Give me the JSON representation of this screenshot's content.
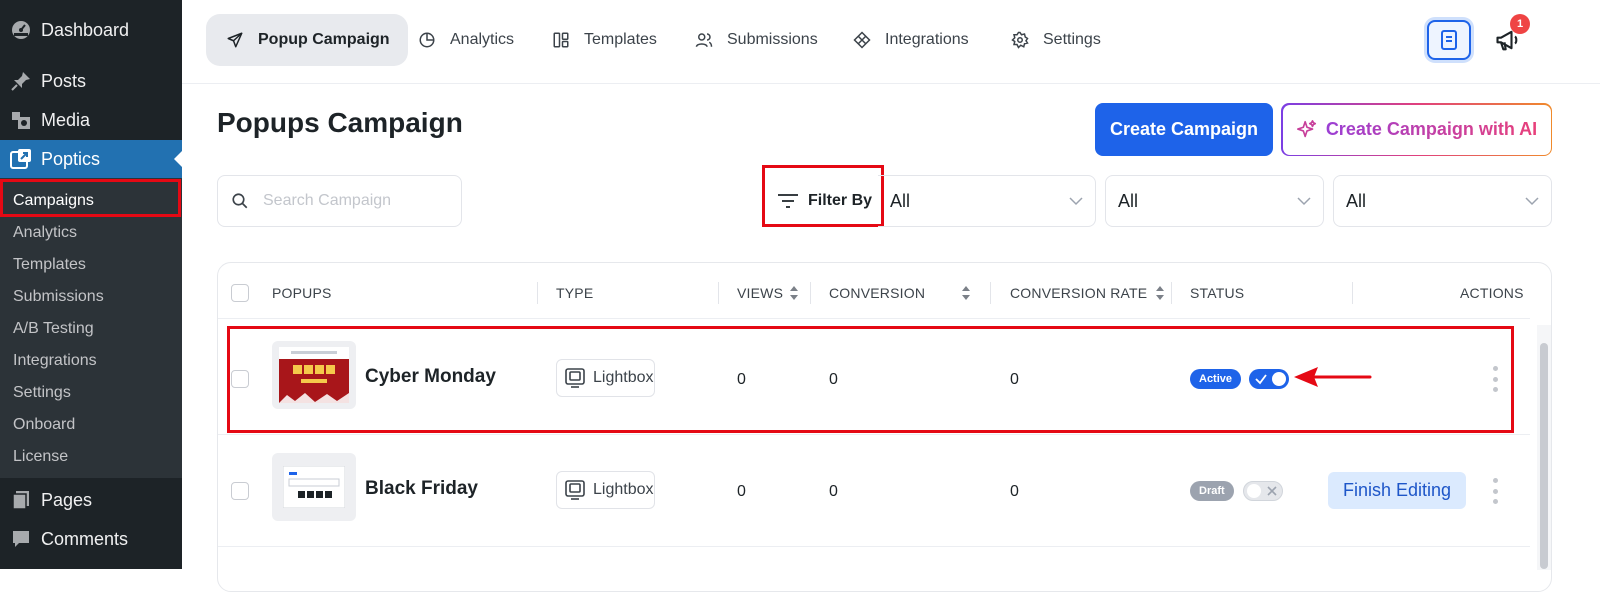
{
  "wp_menu": {
    "dashboard": "Dashboard",
    "posts": "Posts",
    "media": "Media",
    "poptics": "Poptics",
    "pages": "Pages",
    "comments": "Comments"
  },
  "submenu": [
    "Campaigns",
    "Analytics",
    "Templates",
    "Submissions",
    "A/B Testing",
    "Integrations",
    "Settings",
    "Onboard",
    "License"
  ],
  "top_tabs": {
    "popup_campaign": "Popup Campaign",
    "analytics": "Analytics",
    "templates": "Templates",
    "submissions": "Submissions",
    "integrations": "Integrations",
    "settings": "Settings"
  },
  "notification_count": "1",
  "header": {
    "title": "Popups Campaign",
    "create_label": "Create Campaign",
    "create_ai_label": "Create Campaign with AI"
  },
  "filters": {
    "search_placeholder": "Search Campaign",
    "filter_label": "Filter By",
    "select_1": "All",
    "select_2": "All",
    "select_3": "All"
  },
  "table": {
    "columns": {
      "popups": "POPUPS",
      "type": "TYPE",
      "views": "VIEWS",
      "conversion": "CONVERSION",
      "conversion_rate": "CONVERSION RATE",
      "status": "STATUS",
      "actions": "ACTIONS"
    },
    "rows": [
      {
        "name": "Cyber Monday",
        "type": "Lightbox",
        "views": "0",
        "conversion": "0",
        "conversion_rate": "0",
        "status": "Active",
        "enabled": true
      },
      {
        "name": "Black Friday",
        "type": "Lightbox",
        "views": "0",
        "conversion": "0",
        "conversion_rate": "0",
        "status": "Draft",
        "enabled": false,
        "action": "Finish Editing"
      }
    ]
  },
  "colors": {
    "wp_sidebar": "#1d2327",
    "wp_active": "#2271b1",
    "primary": "#1e63e9",
    "active_badge": "#1e63e9",
    "draft_badge": "#9ca3af",
    "highlight": "#e50914"
  }
}
